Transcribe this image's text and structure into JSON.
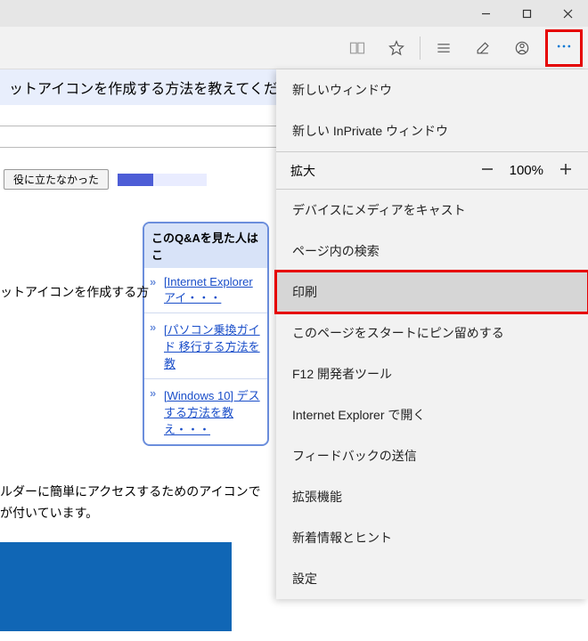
{
  "window": {
    "title": ""
  },
  "page": {
    "heading": "ットアイコンを作成する方法を教えてくだ",
    "feedback_button": "役に立たなかった",
    "left_text": "ットアイコンを作成する方",
    "related_title": "このQ&Aを見た人はこ",
    "related": [
      "[Internet Explorer アイ・・・",
      "[パソコン乗換ガイド 移行する方法を教",
      "[Windows 10] デス する方法を教え・・・"
    ],
    "body_line1": "ルダーに簡単にアクセスするためのアイコンで",
    "body_line2": "が付いています。"
  },
  "zoom": {
    "label": "拡大",
    "value": "100%"
  },
  "menu": [
    {
      "label": "新しいウィンドウ",
      "sep": false
    },
    {
      "label": "新しい InPrivate ウィンドウ",
      "sep": true
    },
    {
      "zoom": true
    },
    {
      "label": "デバイスにメディアをキャスト",
      "sep": false
    },
    {
      "label": "ページ内の検索",
      "sep": false
    },
    {
      "label": "印刷",
      "highlight": true,
      "sep": false
    },
    {
      "label": "このページをスタートにピン留めする",
      "sep": false
    },
    {
      "label": "F12 開発者ツール",
      "sep": false
    },
    {
      "label": "Internet Explorer で開く",
      "sep": false
    },
    {
      "label": "フィードバックの送信",
      "sep": false
    },
    {
      "label": "拡張機能",
      "sep": false
    },
    {
      "label": "新着情報とヒント",
      "sep": false
    },
    {
      "label": "設定",
      "sep": false
    }
  ]
}
